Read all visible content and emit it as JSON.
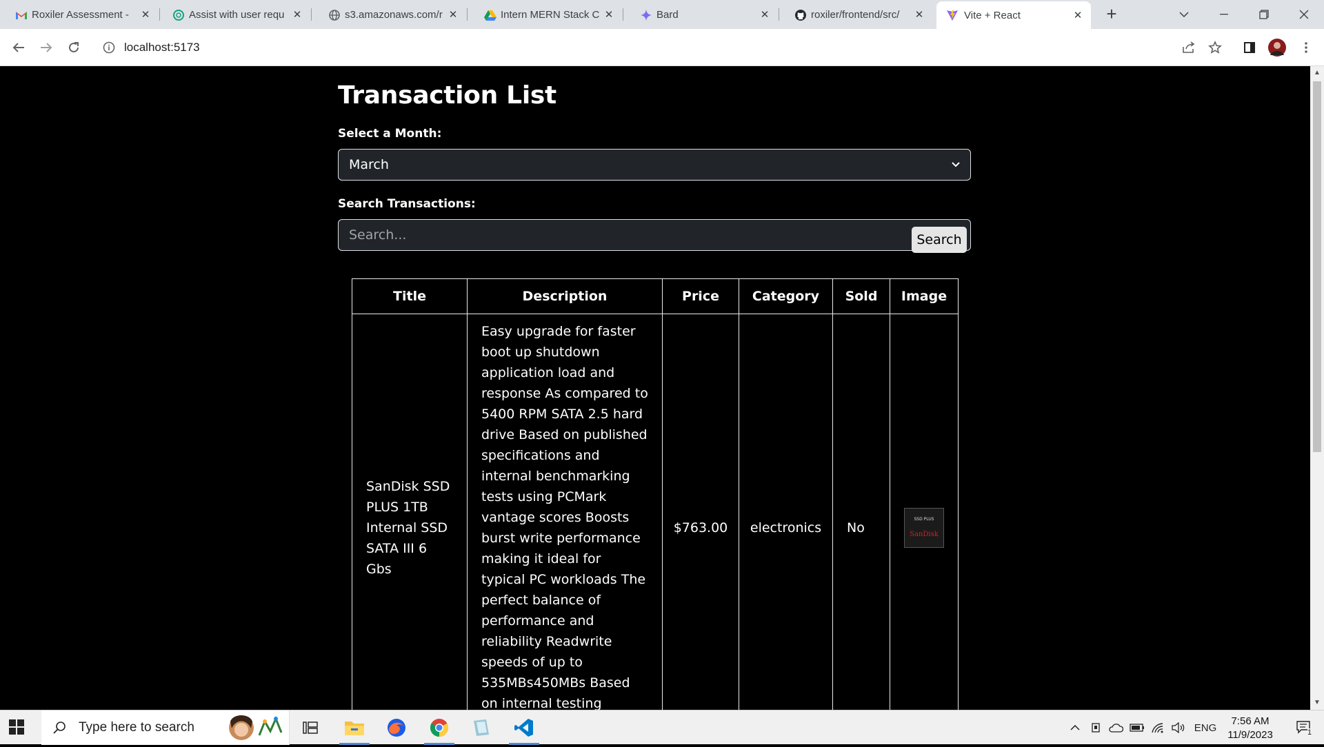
{
  "browser": {
    "tabs": [
      {
        "title": "Roxiler Assessment -",
        "icon": "gmail-icon",
        "active": false
      },
      {
        "title": "Assist with user requ",
        "icon": "chatgpt-icon",
        "active": false
      },
      {
        "title": "s3.amazonaws.com/r",
        "icon": "globe-icon",
        "active": false
      },
      {
        "title": "Intern MERN Stack C",
        "icon": "google-drive-icon",
        "active": false
      },
      {
        "title": "Bard",
        "icon": "bard-icon",
        "active": false
      },
      {
        "title": "roxiler/frontend/src/",
        "icon": "github-icon",
        "active": false
      },
      {
        "title": "Vite + React",
        "icon": "vite-icon",
        "active": true
      }
    ],
    "url": "localhost:5173"
  },
  "page": {
    "title": "Transaction List",
    "month_label": "Select a Month:",
    "month_value": "March",
    "search_label": "Search Transactions:",
    "search_placeholder": "Search...",
    "search_value": "",
    "search_button": "Search",
    "table": {
      "headers": [
        "Title",
        "Description",
        "Price",
        "Category",
        "Sold",
        "Image"
      ],
      "rows": [
        {
          "title": "SanDisk SSD PLUS 1TB Internal SSD SATA III 6 Gbs",
          "description": "Easy upgrade for faster boot up shutdown application load and response As compared to 5400 RPM SATA 2.5 hard drive Based on published specifications and internal benchmarking tests using PCMark vantage scores Boosts burst write performance making it ideal for typical PC workloads The perfect balance of performance and reliability Readwrite speeds of up to 535MBs450MBs Based on internal testing Performance may vary",
          "price": "$763.00",
          "category": "electronics",
          "sold": "No",
          "image_top_text": "SSD PLUS",
          "image_brand_text": "SanDisk"
        }
      ]
    }
  },
  "taskbar": {
    "search_placeholder": "Type here to search",
    "apps": [
      "task-view-icon",
      "file-explorer-icon",
      "firefox-icon",
      "chrome-icon",
      "app-icon",
      "vscode-icon"
    ],
    "language": "ENG",
    "time": "7:56 AM",
    "date": "11/9/2023",
    "notification_count": "1"
  },
  "colors": {
    "page_bg": "#000000",
    "input_bg": "#212529",
    "border": "#dee2e6",
    "chrome_tabstrip": "#dee1e6",
    "taskbar_accent": "#4f8bd6"
  }
}
